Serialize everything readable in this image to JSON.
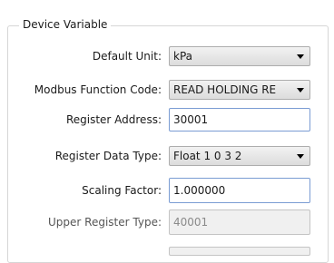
{
  "group": {
    "title": "Device  Variable"
  },
  "fields": {
    "default_unit": {
      "label": "Default Unit:",
      "value": "kPa"
    },
    "modbus_function_code": {
      "label": "Modbus Function Code:",
      "value": "READ HOLDING RE"
    },
    "register_address": {
      "label": "Register Address:",
      "value": "30001"
    },
    "register_data_type": {
      "label": "Register Data Type:",
      "value": "Float 1 0 3 2"
    },
    "scaling_factor": {
      "label": "Scaling Factor:",
      "value": "1.000000"
    },
    "upper_register_type": {
      "label": "Upper Register Type:",
      "value": "40001"
    }
  }
}
